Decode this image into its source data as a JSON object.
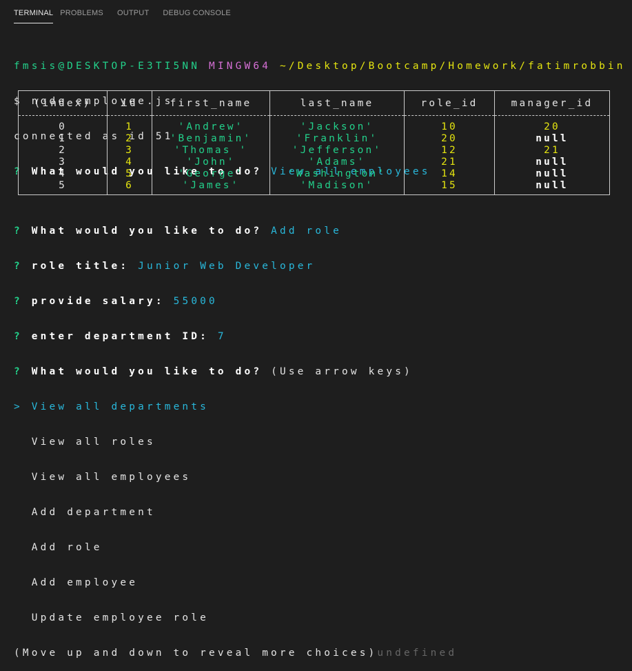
{
  "tabs": [
    "TERMINAL",
    "PROBLEMS",
    "OUTPUT",
    "DEBUG CONSOLE"
  ],
  "prompt": {
    "user_host": "fmsis@DESKTOP-E3TI5NN",
    "shell": "MINGW64",
    "path": "~/Desktop/Bootcamp/Homework/fatimrobbin"
  },
  "lines": {
    "cmd": "$ node employee.js",
    "connected": "connected as id 51",
    "q1_mark": "?",
    "q1_text": "What would you like to do?",
    "q1_answer": "View all employees"
  },
  "table": {
    "headers": [
      "(index)",
      "id",
      "first_name",
      "last_name",
      "role_id",
      "manager_id"
    ],
    "rows": [
      [
        "0",
        "1",
        "'Andrew'",
        "'Jackson'",
        "10",
        "20"
      ],
      [
        "1",
        "2",
        "'Benjamin'",
        "'Franklin'",
        "20",
        "null"
      ],
      [
        "2",
        "3",
        "'Thomas '",
        "'Jefferson'",
        "12",
        "21"
      ],
      [
        "3",
        "4",
        "'John'",
        "'Adams'",
        "21",
        "null"
      ],
      [
        "4",
        "5",
        "'George'",
        "'Washington'",
        "14",
        "null"
      ],
      [
        "5",
        "6",
        "'James'",
        "'Madison'",
        "15",
        "null"
      ]
    ]
  },
  "after": {
    "q2_text": "What would you like to do?",
    "q2_answer": "Add role",
    "q3_text": "role title:",
    "q3_answer": "Junior Web Developer",
    "q4_text": "provide salary:",
    "q4_answer": "55000",
    "q5_text": "enter department ID:",
    "q5_answer": "7",
    "q6_text": "What would you like to do?",
    "q6_hint": "(Use arrow keys)",
    "pointer": ">",
    "choices": [
      "View all departments",
      "View all roles",
      "View all employees",
      "Add department",
      "Add role",
      "Add employee",
      "Update employee role"
    ],
    "more_hint": "(Move up and down to reveal more choices)",
    "undefined": "undefined"
  },
  "colors": {
    "background": "#1e1e1e",
    "green": "#23d18b",
    "magenta": "#d670d6",
    "yellow": "#e5e510",
    "cyan": "#29b8db"
  }
}
